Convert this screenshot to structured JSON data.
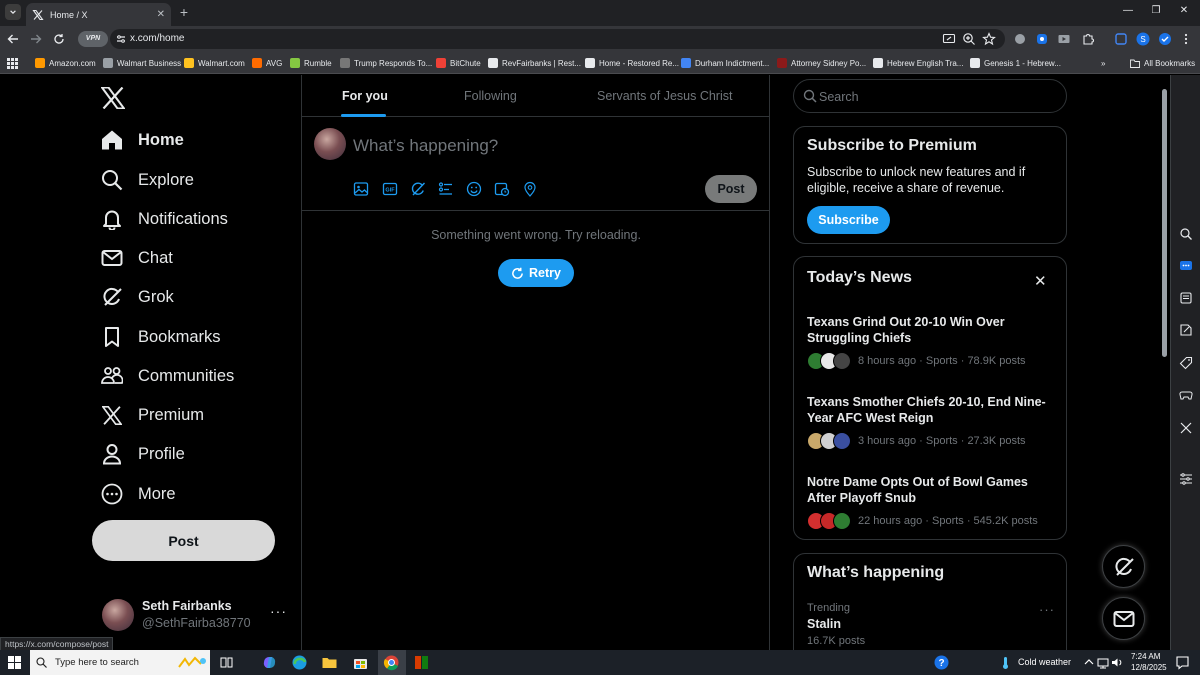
{
  "browser": {
    "tab_title": "Home / X",
    "url": "x.com/home",
    "vpn_label": "VPN",
    "status_url": "https://x.com/compose/post",
    "bookmarks": [
      {
        "label": "Amazon.com",
        "color": "#ff9900"
      },
      {
        "label": "Walmart Business",
        "color": "#9aa0a6"
      },
      {
        "label": "Walmart.com",
        "color": "#ffc220"
      },
      {
        "label": "AVG",
        "color": "#ff6b00"
      },
      {
        "label": "Rumble",
        "color": "#85c742"
      },
      {
        "label": "Trump Responds To...",
        "color": "#777777"
      },
      {
        "label": "BitChute",
        "color": "#ef4137"
      },
      {
        "label": "RevFairbanks | Rest...",
        "color": "#e8eaed"
      },
      {
        "label": "Home - Restored Re...",
        "color": "#e8eaed"
      },
      {
        "label": "Durham Indictment...",
        "color": "#4285f4"
      },
      {
        "label": "Attorney Sidney Po...",
        "color": "#8b1a1a"
      },
      {
        "label": "Hebrew English Tra...",
        "color": "#e8eaed"
      },
      {
        "label": "Genesis 1 - Hebrew...",
        "color": "#e8eaed"
      }
    ],
    "all_bookmarks": "All Bookmarks"
  },
  "nav": {
    "items": [
      {
        "label": "Home",
        "icon": "home-icon"
      },
      {
        "label": "Explore",
        "icon": "search-icon"
      },
      {
        "label": "Notifications",
        "icon": "bell-icon"
      },
      {
        "label": "Chat",
        "icon": "mail-icon"
      },
      {
        "label": "Grok",
        "icon": "grok-icon"
      },
      {
        "label": "Bookmarks",
        "icon": "bookmark-icon"
      },
      {
        "label": "Communities",
        "icon": "communities-icon"
      },
      {
        "label": "Premium",
        "icon": "x-icon"
      },
      {
        "label": "Profile",
        "icon": "profile-icon"
      },
      {
        "label": "More",
        "icon": "more-icon"
      }
    ],
    "post_label": "Post"
  },
  "profile": {
    "name": "Seth Fairbanks",
    "handle": "@SethFairba38770",
    "more": "···"
  },
  "feed": {
    "tabs": [
      "For you",
      "Following",
      "Servants of Jesus Christ"
    ],
    "composer_placeholder": "What’s happening?",
    "composer_post": "Post",
    "error_message": "Something went wrong. Try reloading.",
    "retry_label": "Retry"
  },
  "sidebar": {
    "search_placeholder": "Search",
    "premium": {
      "title": "Subscribe to Premium",
      "text": "Subscribe to unlock new features and if eligible, receive a share of revenue.",
      "button": "Subscribe"
    },
    "news": {
      "title": "Today’s News",
      "close": "✕",
      "items": [
        {
          "headline": "Texans Grind Out 20-10 Win Over Struggling Chiefs",
          "meta": "8 hours ago · Sports · 78.9K posts",
          "faces": [
            "#2e7d32",
            "#e8e8e8",
            "#444444"
          ]
        },
        {
          "headline": "Texans Smother Chiefs 20-10, End Nine-Year AFC West Reign",
          "meta": "3 hours ago · Sports · 27.3K posts",
          "faces": [
            "#c9a86a",
            "#d0d0d0",
            "#3a4fa0"
          ]
        },
        {
          "headline": "Notre Dame Opts Out of Bowl Games After Playoff Snub",
          "meta": "22 hours ago · Sports · 545.2K posts",
          "faces": [
            "#d32f2f",
            "#c62828",
            "#2e7d32"
          ]
        }
      ]
    },
    "happening": {
      "title": "What’s happening",
      "trend_label": "Trending",
      "trend_name": "Stalin",
      "trend_count": "16.7K posts",
      "more": "···"
    }
  },
  "taskbar": {
    "search_placeholder": "Type here to search",
    "weather": "Cold weather",
    "time": "7:24 AM",
    "date": "12/8/2025"
  },
  "colors": {
    "accent": "#1d9bf0",
    "background": "#000000",
    "border": "#2f3336",
    "muted_text": "#71767b"
  }
}
